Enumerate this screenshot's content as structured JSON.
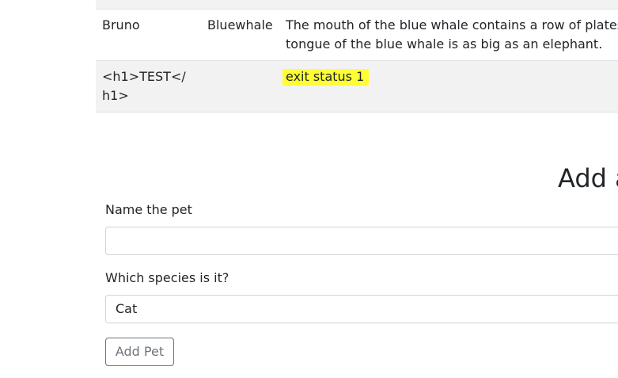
{
  "pets_table": {
    "rows": [
      {
        "name": "Bruno",
        "species": "Bluewhale",
        "description": "The mouth of the blue whale contains a row of plates\ntongue of the blue whale is as big as an elephant."
      },
      {
        "name": "<h1>TEST</\nh1>",
        "species": "",
        "description": "exit status 1"
      }
    ]
  },
  "add_form": {
    "title": "Add a",
    "name_label": "Name the pet",
    "name_value": "",
    "species_label": "Which species is it?",
    "species_selected": "Cat",
    "submit_label": "Add Pet"
  },
  "colors": {
    "stripe": "#f2f2f2",
    "highlight": "#ffff33",
    "button_text": "#6c757d"
  }
}
